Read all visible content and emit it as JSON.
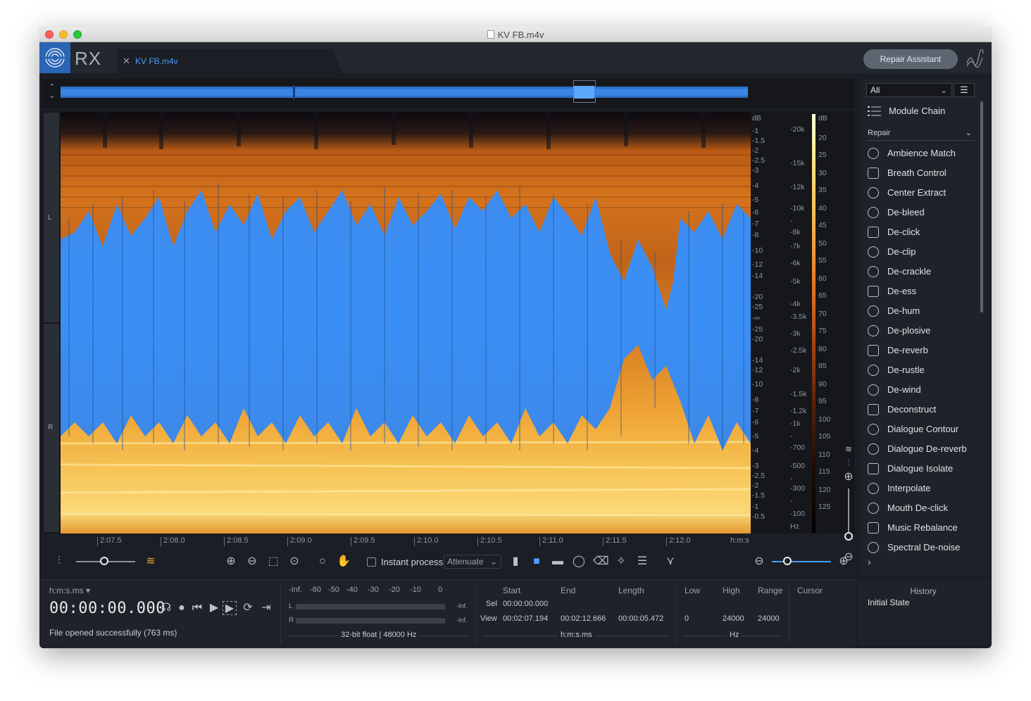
{
  "window": {
    "title": "KV FB.m4v"
  },
  "app": {
    "logo": "RX",
    "tab_name": "KV FB.m4v",
    "repair_assistant": "Repair Assistant"
  },
  "channels": {
    "left": "L",
    "right": "R"
  },
  "db_axis_left": [
    "dB",
    "-1",
    "-1.5",
    "-2",
    "-2.5",
    "-3",
    "-4",
    "-5",
    "-6",
    "-7",
    "-8",
    "-10",
    "-12",
    "-14",
    "-20",
    "-25",
    "-∞",
    "-25",
    "-20",
    "-14",
    "-12",
    "-10",
    "-8",
    "-7",
    "-6",
    "-5",
    "-4",
    "-3",
    "-2.5",
    "-2",
    "-1.5",
    "-1",
    "-0.5"
  ],
  "hz_axis": [
    "-20k",
    "-15k",
    "-12k",
    "-10k",
    "-",
    "-8k",
    "-7k",
    "-6k",
    "-5k",
    "-4k",
    "-3.5k",
    "-3k",
    "-2.5k",
    "-2k",
    "-1.5k",
    "-1.2k",
    "-1k",
    "-",
    "-700",
    "-500",
    "-",
    "-300",
    "-",
    "-100",
    "Hz"
  ],
  "db_axis_right": [
    "dB",
    "20",
    "25",
    "30",
    "35",
    "40",
    "45",
    "50",
    "55",
    "60",
    "65",
    "70",
    "75",
    "80",
    "85",
    "90",
    "95",
    "100",
    "105",
    "110",
    "115",
    "120",
    "125"
  ],
  "timeline": [
    "2:07.5",
    "2:08.0",
    "2:08.5",
    "2:09.0",
    "2:09.5",
    "2:10.0",
    "2:10.5",
    "2:11.0",
    "2:11.5",
    "2:12.0",
    "h:m:s"
  ],
  "toolbar": {
    "instant_process": "Instant process",
    "attenuate": "Attenuate"
  },
  "transport": {
    "time_format": "h:m:s.ms",
    "time": "00:00:00.000",
    "status": "File opened successfully (763 ms)"
  },
  "meter": {
    "scale": [
      "-Inf.",
      "-60",
      "-50",
      "-40",
      "-30",
      "-20",
      "-10",
      "0"
    ],
    "l_label": "L",
    "r_label": "R",
    "l_value": "-Inf.",
    "r_value": "-Inf.",
    "format": "32-bit float | 48000 Hz"
  },
  "selection": {
    "start_h": "Start",
    "end_h": "End",
    "length_h": "Length",
    "sel_label": "Sel",
    "sel_start": "00:00:00.000",
    "view_label": "View",
    "view_start": "00:02:07.194",
    "view_end": "00:02:12.666",
    "view_length": "00:00:05.472",
    "unit": "h:m:s.ms"
  },
  "frequency": {
    "low_h": "Low",
    "high_h": "High",
    "range_h": "Range",
    "low": "0",
    "high": "24000",
    "range": "24000",
    "unit": "Hz"
  },
  "cursor": {
    "label": "Cursor"
  },
  "modules": {
    "filter": "All",
    "module_chain": "Module Chain",
    "category": "Repair",
    "items": [
      "Ambience Match",
      "Breath Control",
      "Center Extract",
      "De-bleed",
      "De-click",
      "De-clip",
      "De-crackle",
      "De-ess",
      "De-hum",
      "De-plosive",
      "De-reverb",
      "De-rustle",
      "De-wind",
      "Deconstruct",
      "Dialogue Contour",
      "Dialogue De-reverb",
      "Dialogue Isolate",
      "Interpolate",
      "Mouth De-click",
      "Music Rebalance",
      "Spectral De-noise"
    ],
    "more": "›"
  },
  "history": {
    "title": "History",
    "item": "Initial State"
  },
  "colors": {
    "accent": "#4a9cff",
    "waveform": "#3a8ff5",
    "panel": "#1f2329"
  }
}
